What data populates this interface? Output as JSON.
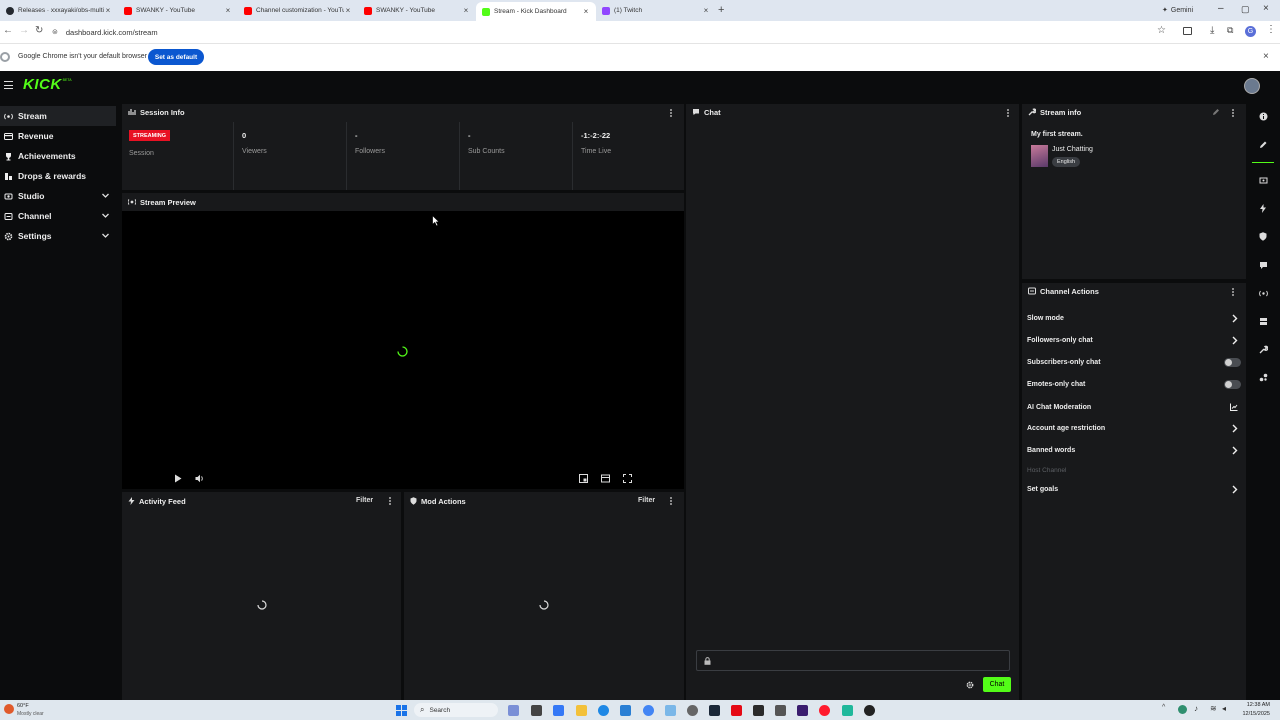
{
  "browser": {
    "tabs": [
      {
        "title": "Releases · xxxayaki/obs-multi-rtmp",
        "color": "#24292f"
      },
      {
        "title": "SWANKY - YouTube",
        "color": "#ff0000"
      },
      {
        "title": "Channel customization - YouTube",
        "color": "#ff0000"
      },
      {
        "title": "SWANKY - YouTube",
        "color": "#ff0000"
      },
      {
        "title": "Stream - Kick Dashboard",
        "color": "#53fc18"
      },
      {
        "title": "(1) Twitch",
        "color": "#9146ff"
      }
    ],
    "gemini_label": "Gemini",
    "url": "dashboard.kick.com/stream",
    "profile_initial": "G",
    "notice_text": "Google Chrome isn't your default browser",
    "set_default_label": "Set as default"
  },
  "kick": {
    "logo_text": "KICK",
    "logo_badge": "BETA"
  },
  "sidebar": {
    "items": [
      {
        "label": "Stream",
        "icon": "stream-icon"
      },
      {
        "label": "Revenue",
        "icon": "revenue-icon"
      },
      {
        "label": "Achievements",
        "icon": "trophy-icon"
      },
      {
        "label": "Drops & rewards",
        "icon": "drops-icon"
      },
      {
        "label": "Studio",
        "icon": "studio-icon"
      },
      {
        "label": "Channel",
        "icon": "channel-icon"
      },
      {
        "label": "Settings",
        "icon": "settings-icon"
      }
    ]
  },
  "session": {
    "title": "Session Info",
    "badge": "STREAMING",
    "session_label": "Session",
    "stats": [
      {
        "value": "0",
        "label": "Viewers"
      },
      {
        "value": "-",
        "label": "Followers"
      },
      {
        "value": "-",
        "label": "Sub Counts"
      },
      {
        "value": "-1:-2:-22",
        "label": "Time Live"
      }
    ]
  },
  "preview": {
    "title": "Stream Preview"
  },
  "activity": {
    "title": "Activity Feed",
    "filter_label": "Filter"
  },
  "mod_actions": {
    "title": "Mod Actions",
    "filter_label": "Filter"
  },
  "chat": {
    "title": "Chat",
    "send_label": "Chat"
  },
  "stream_info": {
    "title": "Stream info",
    "stream_title": "My first stream.",
    "category": "Just Chatting",
    "language": "English"
  },
  "channel_actions": {
    "title": "Channel Actions",
    "items": [
      {
        "label": "Slow mode",
        "control": "arrow"
      },
      {
        "label": "Followers-only chat",
        "control": "arrow"
      },
      {
        "label": "Subscribers-only chat",
        "control": "toggle"
      },
      {
        "label": "Emotes-only chat",
        "control": "toggle"
      },
      {
        "label": "AI Chat Moderation",
        "control": "chart"
      },
      {
        "label": "Account age restriction",
        "control": "arrow"
      },
      {
        "label": "Banned words",
        "control": "arrow"
      },
      {
        "label": "Host Channel",
        "control": "none"
      },
      {
        "label": "Set goals",
        "control": "arrow"
      }
    ]
  },
  "taskbar": {
    "weather_temp": "60°F",
    "weather_desc": "Mostly clear",
    "search_label": "Search",
    "time": "12:38 AM",
    "date": "12/15/2025"
  },
  "colors": {
    "kick_green": "#53fc18",
    "badge_red": "#e81123"
  }
}
